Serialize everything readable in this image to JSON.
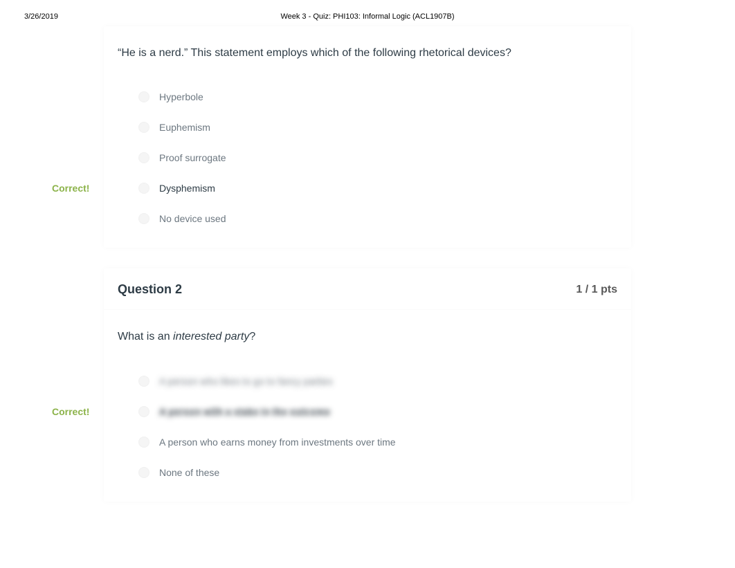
{
  "header": {
    "date": "3/26/2019",
    "title": "Week 3 - Quiz: PHI103: Informal Logic (ACL1907B)"
  },
  "correct_label": "Correct!",
  "q1": {
    "text": "“He is a nerd.” This statement employs which of the following rhetorical devices?",
    "answers": [
      {
        "text": "Hyperbole",
        "selected": false
      },
      {
        "text": "Euphemism",
        "selected": false
      },
      {
        "text": "Proof surrogate",
        "selected": false
      },
      {
        "text": "Dysphemism",
        "selected": true
      },
      {
        "text": "No device used",
        "selected": false
      }
    ]
  },
  "q2": {
    "title": "Question 2",
    "pts": "1 / 1 pts",
    "text_pre": "What is an ",
    "text_italic": "interested party",
    "text_post": "?",
    "answers": [
      {
        "text": "A person who likes to go to fancy parties",
        "selected": false,
        "blurred": true
      },
      {
        "text": "A person with a stake in the outcome",
        "selected": true,
        "blurred": true
      },
      {
        "text": "A person who earns money from investments over time",
        "selected": false,
        "blurred": false
      },
      {
        "text": "None of these",
        "selected": false,
        "blurred": false
      }
    ]
  }
}
